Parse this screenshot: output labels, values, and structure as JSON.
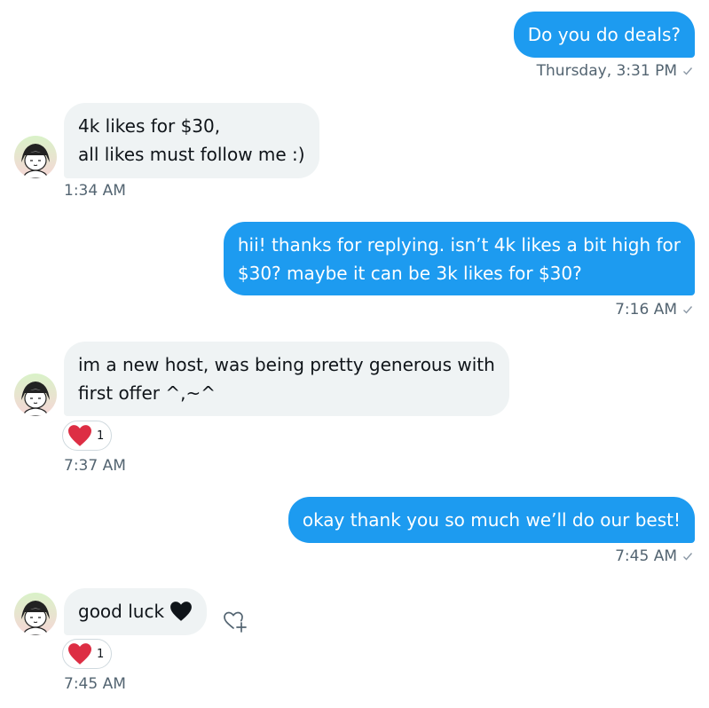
{
  "conversation": {
    "messages": [
      {
        "direction": "outgoing",
        "text": "Do you do deals?",
        "time": "Thursday, 3:31 PM"
      },
      {
        "direction": "incoming",
        "text": "4k likes for $30,\nall likes must follow me :)",
        "time": "1:34 AM"
      },
      {
        "direction": "outgoing",
        "text": "hii! thanks for replying. isn’t 4k likes a bit high for\n$30? maybe it can be 3k likes for $30?",
        "time": "7:16 AM"
      },
      {
        "direction": "incoming",
        "text": "im a new host, was being pretty generous with\nfirst offer ^,~^",
        "reaction": {
          "icon": "red-heart-icon",
          "count": "1"
        },
        "time": "7:37 AM"
      },
      {
        "direction": "outgoing",
        "text": "okay thank you so much we’ll do our best!",
        "time": "7:45 AM"
      },
      {
        "direction": "incoming",
        "text": "good luck",
        "emoji": "black-heart-icon",
        "reaction": {
          "icon": "red-heart-icon",
          "count": "1"
        },
        "time": "7:45 AM"
      }
    ]
  },
  "colors": {
    "outgoing_bubble": "#1d9bf0",
    "incoming_bubble": "#eff3f4",
    "meta_text": "#536471",
    "reaction_heart": "#e0245e"
  }
}
